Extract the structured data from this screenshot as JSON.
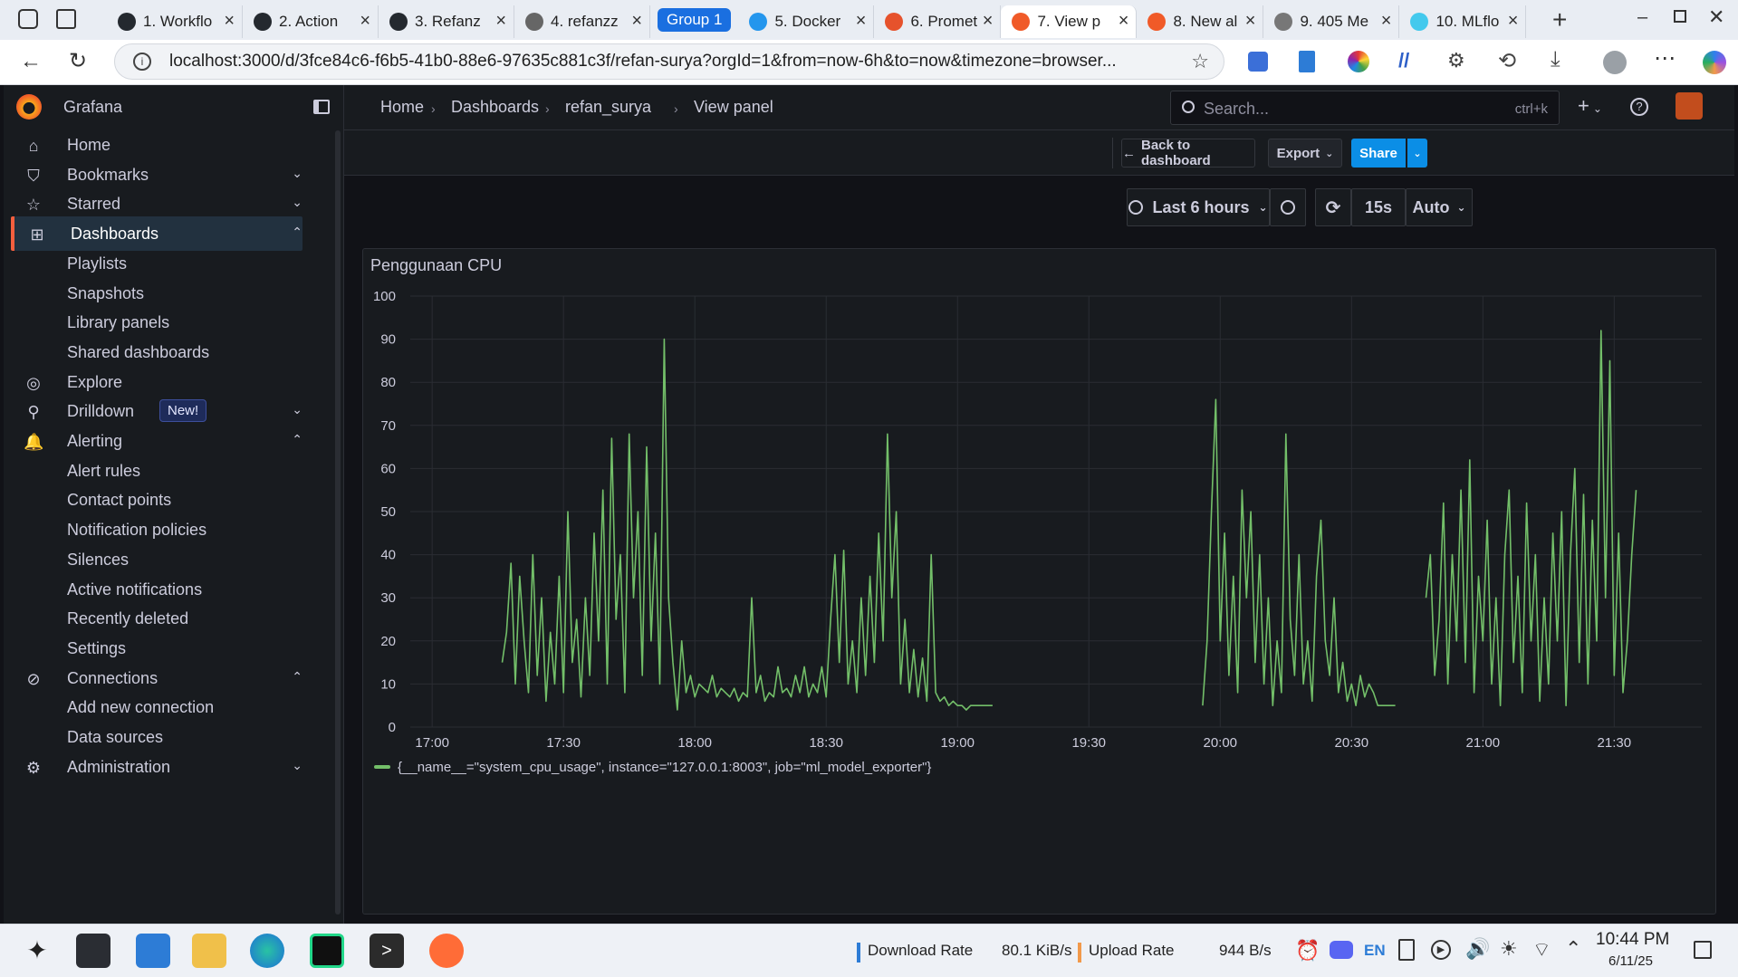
{
  "browser": {
    "tabs": [
      {
        "label": "1. Workflo",
        "color": "#24292f"
      },
      {
        "label": "2. Action",
        "color": "#24292f"
      },
      {
        "label": "3. Refanz",
        "color": "#24292f"
      },
      {
        "label": "4. refanzz",
        "color": "#666666"
      },
      {
        "label": "5. Docker",
        "color": "#2496ed"
      },
      {
        "label": "6. Promet",
        "color": "#e6522c"
      },
      {
        "label": "7. View p",
        "color": "#f05a28"
      },
      {
        "label": "8. New al",
        "color": "#f05a28"
      },
      {
        "label": "9. 405 Me",
        "color": "#777777"
      },
      {
        "label": "10. MLflo",
        "color": "#43c9ed"
      }
    ],
    "group_label": "Group 1",
    "url": "localhost:3000/d/3fce84c6-f6b5-41b0-88e6-97635c881c3f/refan-surya?orgId=1&from=now-6h&to=now&timezone=browser..."
  },
  "grafana": {
    "brand": "Grafana",
    "search_placeholder": "Search...",
    "search_shortcut": "ctrl+k",
    "breadcrumbs": [
      "Home",
      "Dashboards",
      "refan_surya",
      "View panel"
    ],
    "nav": [
      {
        "label": "Home",
        "icon": "home-icon",
        "chev": ""
      },
      {
        "label": "Bookmarks",
        "icon": "bookmark-icon",
        "chev": "v"
      },
      {
        "label": "Starred",
        "icon": "star-icon",
        "chev": "v"
      },
      {
        "label": "Dashboards",
        "icon": "apps-icon",
        "chev": "^",
        "active": true
      },
      {
        "label": "Playlists",
        "sub": true
      },
      {
        "label": "Snapshots",
        "sub": true
      },
      {
        "label": "Library panels",
        "sub": true
      },
      {
        "label": "Shared dashboards",
        "sub": true
      },
      {
        "label": "Explore",
        "icon": "compass-icon",
        "chev": ""
      },
      {
        "label": "Drilldown",
        "icon": "drilldown-icon",
        "chev": "v",
        "badge": "New!"
      },
      {
        "label": "Alerting",
        "icon": "bell-icon",
        "chev": "^"
      },
      {
        "label": "Alert rules",
        "sub": true
      },
      {
        "label": "Contact points",
        "sub": true
      },
      {
        "label": "Notification policies",
        "sub": true
      },
      {
        "label": "Silences",
        "sub": true
      },
      {
        "label": "Active notifications",
        "sub": true
      },
      {
        "label": "Recently deleted",
        "sub": true
      },
      {
        "label": "Settings",
        "sub": true
      },
      {
        "label": "Connections",
        "icon": "link-icon",
        "chev": "^"
      },
      {
        "label": "Add new connection",
        "sub": true
      },
      {
        "label": "Data sources",
        "sub": true
      },
      {
        "label": "Administration",
        "icon": "gear-icon",
        "chev": "v"
      }
    ],
    "buttons": {
      "back": "Back to dashboard",
      "export": "Export",
      "share": "Share"
    },
    "timepicker": {
      "range": "Last 6 hours",
      "refresh": "15s",
      "mode": "Auto"
    },
    "panel_title": "Penggunaan CPU"
  },
  "chart_data": {
    "type": "line",
    "title": "Penggunaan CPU",
    "ylim": [
      0,
      100
    ],
    "yticks": [
      0,
      10,
      20,
      30,
      40,
      50,
      60,
      70,
      80,
      90,
      100
    ],
    "xticks": [
      "17:00",
      "17:30",
      "18:00",
      "18:30",
      "19:00",
      "19:30",
      "20:00",
      "20:30",
      "21:00",
      "21:30",
      "22:00",
      "22:30"
    ],
    "x_range_minutes": [
      -5,
      290
    ],
    "series": [
      {
        "name": "{__name__=\"system_cpu_usage\", instance=\"127.0.0.1:8003\", job=\"ml_model_exporter\"}",
        "color": "#73bf69",
        "segments": [
          [
            [
              16,
              15
            ],
            [
              17,
              22
            ],
            [
              18,
              38
            ],
            [
              19,
              10
            ],
            [
              20,
              35
            ],
            [
              21,
              20
            ],
            [
              22,
              8
            ],
            [
              23,
              40
            ],
            [
              24,
              12
            ],
            [
              25,
              30
            ],
            [
              26,
              6
            ],
            [
              27,
              22
            ],
            [
              28,
              10
            ],
            [
              29,
              35
            ],
            [
              30,
              8
            ],
            [
              31,
              50
            ],
            [
              32,
              15
            ],
            [
              33,
              25
            ],
            [
              34,
              7
            ],
            [
              35,
              30
            ],
            [
              36,
              12
            ],
            [
              37,
              45
            ],
            [
              38,
              20
            ],
            [
              39,
              55
            ],
            [
              40,
              10
            ],
            [
              41,
              67
            ],
            [
              42,
              25
            ],
            [
              43,
              40
            ],
            [
              44,
              8
            ],
            [
              45,
              68
            ],
            [
              46,
              30
            ],
            [
              47,
              50
            ],
            [
              48,
              12
            ],
            [
              49,
              65
            ],
            [
              50,
              20
            ],
            [
              51,
              45
            ],
            [
              52,
              10
            ],
            [
              53,
              90
            ],
            [
              54,
              30
            ],
            [
              55,
              15
            ],
            [
              56,
              4
            ],
            [
              57,
              20
            ],
            [
              58,
              8
            ],
            [
              59,
              12
            ],
            [
              60,
              7
            ],
            [
              61,
              10
            ],
            [
              62,
              9
            ],
            [
              63,
              8
            ],
            [
              64,
              12
            ],
            [
              65,
              7
            ],
            [
              66,
              9
            ],
            [
              67,
              8
            ],
            [
              68,
              7
            ],
            [
              69,
              9
            ],
            [
              70,
              6
            ],
            [
              71,
              8
            ],
            [
              72,
              7
            ],
            [
              73,
              30
            ],
            [
              74,
              8
            ],
            [
              75,
              12
            ],
            [
              76,
              6
            ],
            [
              77,
              8
            ],
            [
              78,
              7
            ],
            [
              79,
              14
            ],
            [
              80,
              8
            ],
            [
              81,
              9
            ],
            [
              82,
              7
            ],
            [
              83,
              12
            ],
            [
              84,
              8
            ],
            [
              85,
              14
            ],
            [
              86,
              7
            ],
            [
              87,
              10
            ],
            [
              88,
              8
            ],
            [
              89,
              14
            ],
            [
              90,
              7
            ],
            [
              91,
              25
            ],
            [
              92,
              40
            ],
            [
              93,
              15
            ],
            [
              94,
              41
            ],
            [
              95,
              10
            ],
            [
              96,
              20
            ],
            [
              97,
              8
            ],
            [
              98,
              30
            ],
            [
              99,
              12
            ],
            [
              100,
              35
            ],
            [
              101,
              15
            ],
            [
              102,
              45
            ],
            [
              103,
              20
            ],
            [
              104,
              68
            ],
            [
              105,
              30
            ],
            [
              106,
              50
            ],
            [
              107,
              10
            ],
            [
              108,
              25
            ],
            [
              109,
              8
            ],
            [
              110,
              18
            ],
            [
              111,
              7
            ],
            [
              112,
              16
            ],
            [
              113,
              6
            ],
            [
              114,
              40
            ],
            [
              115,
              8
            ],
            [
              116,
              6
            ],
            [
              117,
              7
            ],
            [
              118,
              5
            ],
            [
              119,
              6
            ],
            [
              120,
              5
            ],
            [
              121,
              5
            ],
            [
              122,
              4
            ],
            [
              123,
              5
            ],
            [
              124,
              5
            ],
            [
              125,
              5
            ],
            [
              126,
              5
            ],
            [
              127,
              5
            ],
            [
              128,
              5
            ]
          ],
          [
            [
              176,
              5
            ],
            [
              177,
              20
            ],
            [
              178,
              50
            ],
            [
              179,
              76
            ],
            [
              180,
              20
            ],
            [
              181,
              45
            ],
            [
              182,
              12
            ],
            [
              183,
              35
            ],
            [
              184,
              8
            ],
            [
              185,
              55
            ],
            [
              186,
              30
            ],
            [
              187,
              50
            ],
            [
              188,
              15
            ],
            [
              189,
              40
            ],
            [
              190,
              10
            ],
            [
              191,
              30
            ],
            [
              192,
              5
            ],
            [
              193,
              20
            ],
            [
              194,
              8
            ],
            [
              195,
              68
            ],
            [
              196,
              25
            ],
            [
              197,
              12
            ],
            [
              198,
              40
            ],
            [
              199,
              10
            ],
            [
              200,
              20
            ],
            [
              201,
              6
            ],
            [
              202,
              35
            ],
            [
              203,
              48
            ],
            [
              204,
              20
            ],
            [
              205,
              12
            ],
            [
              206,
              30
            ],
            [
              207,
              8
            ],
            [
              208,
              15
            ],
            [
              209,
              6
            ],
            [
              210,
              10
            ],
            [
              211,
              5
            ],
            [
              212,
              12
            ],
            [
              213,
              7
            ],
            [
              214,
              10
            ],
            [
              215,
              8
            ],
            [
              216,
              5
            ],
            [
              217,
              5
            ],
            [
              218,
              5
            ],
            [
              219,
              5
            ],
            [
              220,
              5
            ]
          ],
          [
            [
              227,
              30
            ],
            [
              228,
              40
            ],
            [
              229,
              12
            ],
            [
              230,
              25
            ],
            [
              231,
              52
            ],
            [
              232,
              10
            ],
            [
              233,
              40
            ],
            [
              234,
              20
            ],
            [
              235,
              55
            ],
            [
              236,
              15
            ],
            [
              237,
              62
            ],
            [
              238,
              8
            ],
            [
              239,
              35
            ],
            [
              240,
              20
            ],
            [
              241,
              48
            ],
            [
              242,
              10
            ],
            [
              243,
              30
            ],
            [
              244,
              5
            ],
            [
              245,
              40
            ],
            [
              246,
              55
            ],
            [
              247,
              15
            ],
            [
              248,
              35
            ],
            [
              249,
              8
            ],
            [
              250,
              52
            ],
            [
              251,
              20
            ],
            [
              252,
              40
            ],
            [
              253,
              6
            ],
            [
              254,
              30
            ],
            [
              255,
              10
            ],
            [
              256,
              45
            ],
            [
              257,
              20
            ],
            [
              258,
              50
            ],
            [
              259,
              5
            ],
            [
              260,
              40
            ],
            [
              261,
              60
            ],
            [
              262,
              15
            ],
            [
              263,
              54
            ],
            [
              264,
              10
            ],
            [
              265,
              48
            ],
            [
              266,
              20
            ],
            [
              267,
              92
            ],
            [
              268,
              30
            ],
            [
              269,
              85
            ],
            [
              270,
              12
            ],
            [
              271,
              45
            ],
            [
              272,
              8
            ],
            [
              273,
              20
            ],
            [
              274,
              40
            ],
            [
              275,
              55
            ]
          ]
        ]
      }
    ]
  },
  "taskbar": {
    "download_label": "Download Rate",
    "download_value": "80.1 KiB/s",
    "upload_label": "Upload Rate",
    "upload_value": "944 B/s",
    "lang": "EN",
    "time": "10:44 PM",
    "date": "6/11/25"
  }
}
